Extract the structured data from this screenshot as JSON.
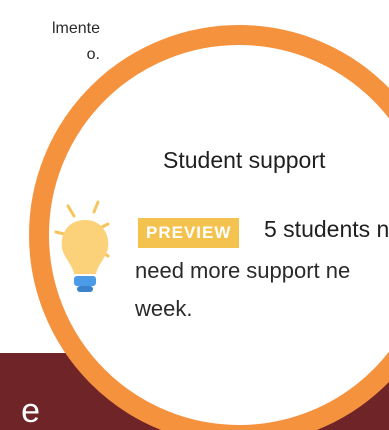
{
  "background": {
    "text_lines": [
      "lmente",
      "o."
    ],
    "footer_text": "e"
  },
  "card": {
    "title": "Student support",
    "badge": "PREVIEW",
    "line1": "5 students n",
    "line2": "need more support ne",
    "line3": "week."
  },
  "colors": {
    "magnifier_ring": "#f5923e",
    "footer_band": "#6f2427",
    "badge": "#f3c24f",
    "bulb": "#fbd27a",
    "bulb_base": "#4b9be8"
  },
  "icons": {
    "bulb": "lightbulb-icon"
  }
}
